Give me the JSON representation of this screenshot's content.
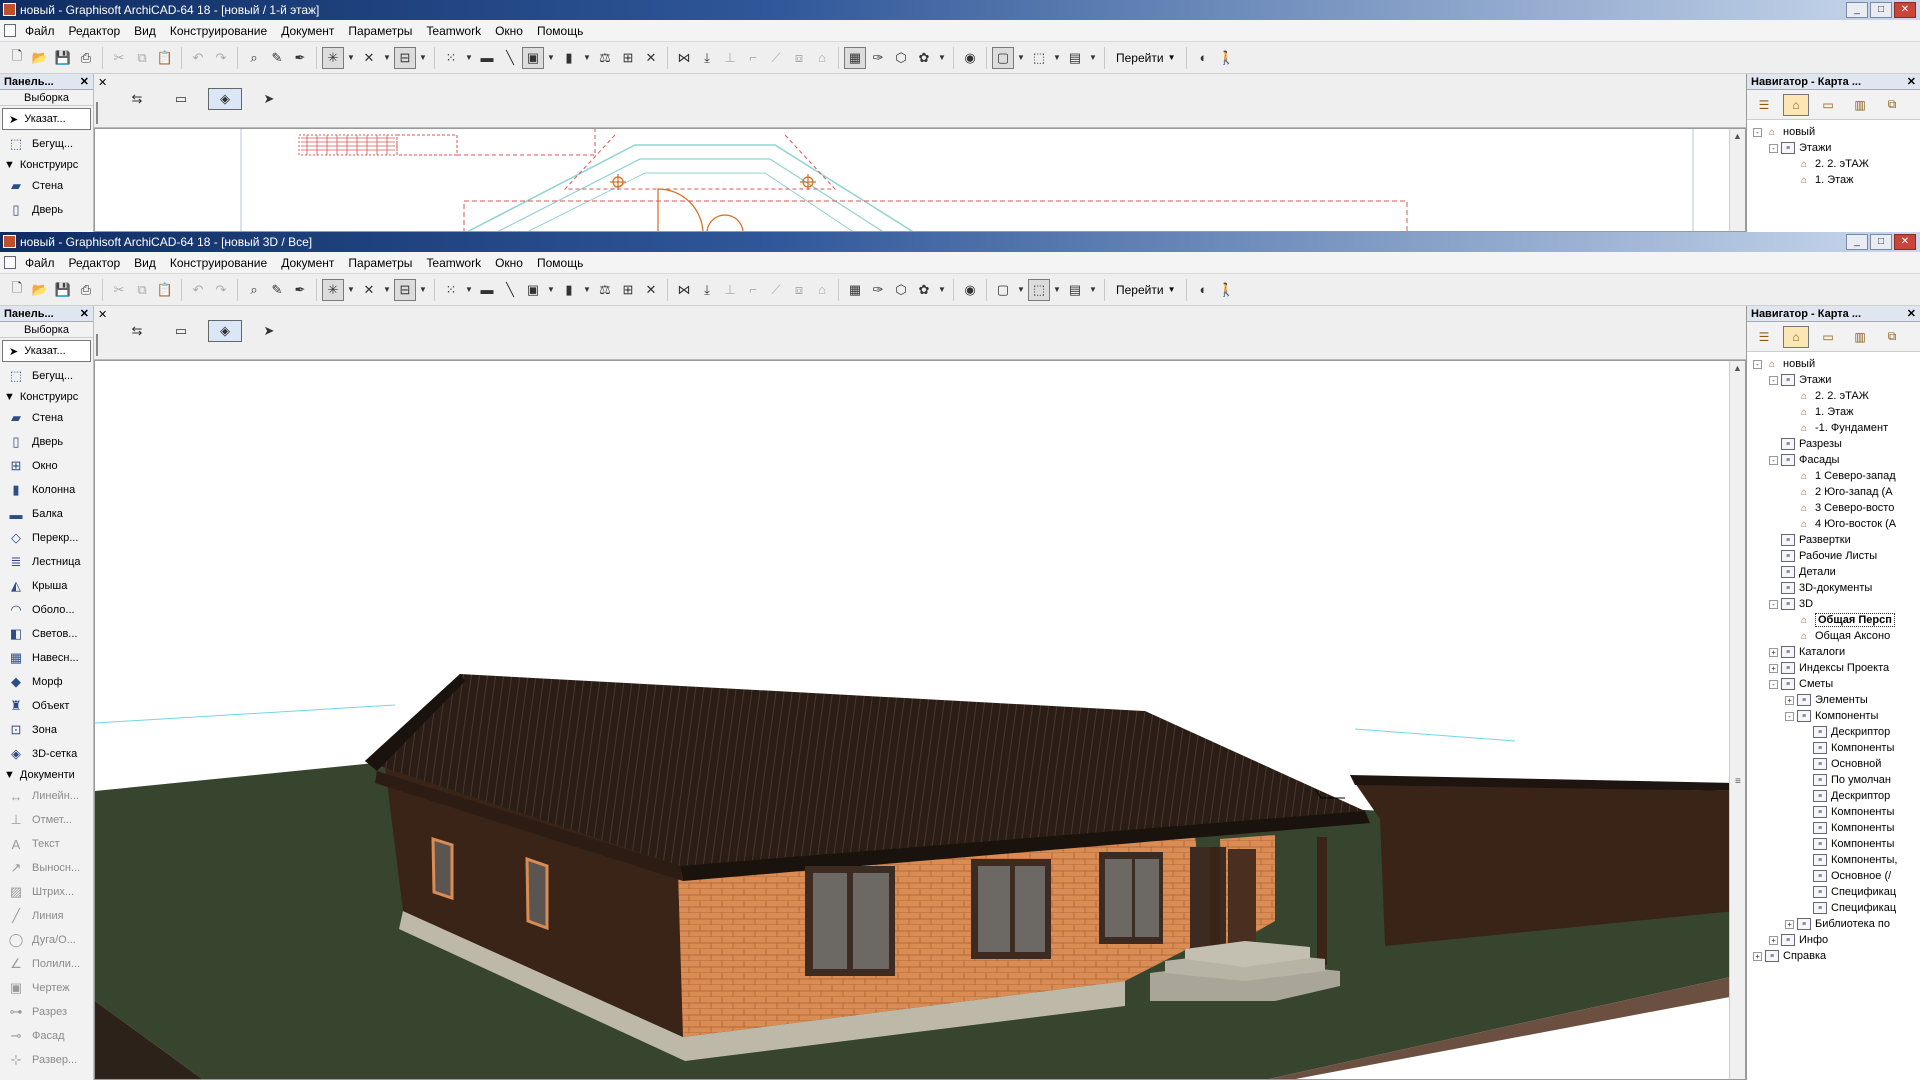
{
  "top_window": {
    "title": "новый - Graphisoft ArchiCAD-64 18 - [новый / 1-й этаж]",
    "nav_title": "Навигатор - Карта ...",
    "nav_items": [
      "новый",
      "Этажи",
      "2. 2. эТАЖ",
      "1. Этаж"
    ]
  },
  "main_window": {
    "title": "новый - Graphisoft ArchiCAD-64 18 - [новый 3D / Все]"
  },
  "menu": [
    "Файл",
    "Редактор",
    "Вид",
    "Конструирование",
    "Документ",
    "Параметры",
    "Teamwork",
    "Окно",
    "Помощь"
  ],
  "toolbar": {
    "goto_label": "Перейти"
  },
  "toolbox": {
    "title": "Панель...",
    "selection": "Выборка",
    "pointer": "Указат...",
    "marquee": "Бегущ...",
    "design_section": "Конструирс",
    "design_tools": [
      {
        "label": "Стена",
        "icon": "wall-icon"
      },
      {
        "label": "Дверь",
        "icon": "door-icon"
      },
      {
        "label": "Окно",
        "icon": "window-icon"
      },
      {
        "label": "Колонна",
        "icon": "column-icon"
      },
      {
        "label": "Балка",
        "icon": "beam-icon"
      },
      {
        "label": "Перекр...",
        "icon": "slab-icon"
      },
      {
        "label": "Лестница",
        "icon": "stair-icon"
      },
      {
        "label": "Крыша",
        "icon": "roof-icon"
      },
      {
        "label": "Оболо...",
        "icon": "shell-icon"
      },
      {
        "label": "Светов...",
        "icon": "skylight-icon"
      },
      {
        "label": "Навесн...",
        "icon": "curtain-wall-icon"
      },
      {
        "label": "Морф",
        "icon": "morph-icon"
      },
      {
        "label": "Объект",
        "icon": "object-icon"
      },
      {
        "label": "Зона",
        "icon": "zone-icon"
      },
      {
        "label": "3D-сетка",
        "icon": "mesh-icon"
      }
    ],
    "document_section": "Документи",
    "document_tools": [
      {
        "label": "Линейн...",
        "icon": "dimension-icon"
      },
      {
        "label": "Отмет...",
        "icon": "level-dimension-icon"
      },
      {
        "label": "Текст",
        "icon": "text-icon"
      },
      {
        "label": "Выносн...",
        "icon": "label-icon"
      },
      {
        "label": "Штрих...",
        "icon": "fill-icon"
      },
      {
        "label": "Линия",
        "icon": "line-icon"
      },
      {
        "label": "Дуга/О...",
        "icon": "arc-icon"
      },
      {
        "label": "Полили...",
        "icon": "polyline-icon"
      },
      {
        "label": "Чертеж",
        "icon": "drawing-icon"
      },
      {
        "label": "Разрез",
        "icon": "section-icon"
      },
      {
        "label": "Фасад",
        "icon": "elevation-icon"
      },
      {
        "label": "Развер...",
        "icon": "interior-elevation-icon"
      }
    ]
  },
  "navigator": {
    "title": "Навигатор - Карта ...",
    "tree": [
      {
        "label": "новый",
        "level": 0,
        "exp": "-",
        "icon": "house"
      },
      {
        "label": "Этажи",
        "level": 1,
        "exp": "-",
        "icon": "doc"
      },
      {
        "label": "2. 2. эТАЖ",
        "level": 2,
        "exp": "",
        "icon": "house"
      },
      {
        "label": "1. Этаж",
        "level": 2,
        "exp": "",
        "icon": "house"
      },
      {
        "label": "-1. Фундамент",
        "level": 2,
        "exp": "",
        "icon": "house"
      },
      {
        "label": "Разрезы",
        "level": 1,
        "exp": "",
        "icon": "doc"
      },
      {
        "label": "Фасады",
        "level": 1,
        "exp": "-",
        "icon": "doc"
      },
      {
        "label": "1 Северо-запад",
        "level": 2,
        "exp": "",
        "icon": "house"
      },
      {
        "label": "2 Юго-запад (А",
        "level": 2,
        "exp": "",
        "icon": "house"
      },
      {
        "label": "3 Северо-восто",
        "level": 2,
        "exp": "",
        "icon": "house"
      },
      {
        "label": "4 Юго-восток (А",
        "level": 2,
        "exp": "",
        "icon": "house"
      },
      {
        "label": "Развертки",
        "level": 1,
        "exp": "",
        "icon": "doc"
      },
      {
        "label": "Рабочие Листы",
        "level": 1,
        "exp": "",
        "icon": "doc"
      },
      {
        "label": "Детали",
        "level": 1,
        "exp": "",
        "icon": "doc"
      },
      {
        "label": "3D-документы",
        "level": 1,
        "exp": "",
        "icon": "doc"
      },
      {
        "label": "3D",
        "level": 1,
        "exp": "-",
        "icon": "doc"
      },
      {
        "label": "Общая Персп",
        "level": 2,
        "exp": "",
        "icon": "house",
        "selected": true
      },
      {
        "label": "Общая Аксоно",
        "level": 2,
        "exp": "",
        "icon": "house"
      },
      {
        "label": "Каталоги",
        "level": 1,
        "exp": "+",
        "icon": "doc"
      },
      {
        "label": "Индексы Проекта",
        "level": 1,
        "exp": "+",
        "icon": "doc"
      },
      {
        "label": "Сметы",
        "level": 1,
        "exp": "-",
        "icon": "doc"
      },
      {
        "label": "Элементы",
        "level": 2,
        "exp": "+",
        "icon": "doc"
      },
      {
        "label": "Компоненты",
        "level": 2,
        "exp": "-",
        "icon": "doc"
      },
      {
        "label": "Дескриптор",
        "level": 3,
        "exp": "",
        "icon": "doc"
      },
      {
        "label": "Компоненты",
        "level": 3,
        "exp": "",
        "icon": "doc"
      },
      {
        "label": "Основной",
        "level": 3,
        "exp": "",
        "icon": "doc"
      },
      {
        "label": "По умолчан",
        "level": 3,
        "exp": "",
        "icon": "doc"
      },
      {
        "label": "Дескриптор",
        "level": 3,
        "exp": "",
        "icon": "doc"
      },
      {
        "label": "Компоненты",
        "level": 3,
        "exp": "",
        "icon": "doc"
      },
      {
        "label": "Компоненты",
        "level": 3,
        "exp": "",
        "icon": "doc"
      },
      {
        "label": "Компоненты",
        "level": 3,
        "exp": "",
        "icon": "doc"
      },
      {
        "label": "Компоненты,",
        "level": 3,
        "exp": "",
        "icon": "doc"
      },
      {
        "label": "Основное (/",
        "level": 3,
        "exp": "",
        "icon": "doc"
      },
      {
        "label": "Спецификац",
        "level": 3,
        "exp": "",
        "icon": "doc"
      },
      {
        "label": "Спецификац",
        "level": 3,
        "exp": "",
        "icon": "doc"
      },
      {
        "label": "Библиотека по",
        "level": 2,
        "exp": "+",
        "icon": "doc"
      },
      {
        "label": "Инфо",
        "level": 1,
        "exp": "+",
        "icon": "doc"
      },
      {
        "label": "Справка",
        "level": 0,
        "exp": "+",
        "icon": "doc"
      }
    ]
  },
  "colors": {
    "roof": "#2a1d16",
    "brick": "#d98c54",
    "dark_wall": "#3a2418",
    "ground": "#37452f",
    "title_dark": "#0f2d63"
  }
}
